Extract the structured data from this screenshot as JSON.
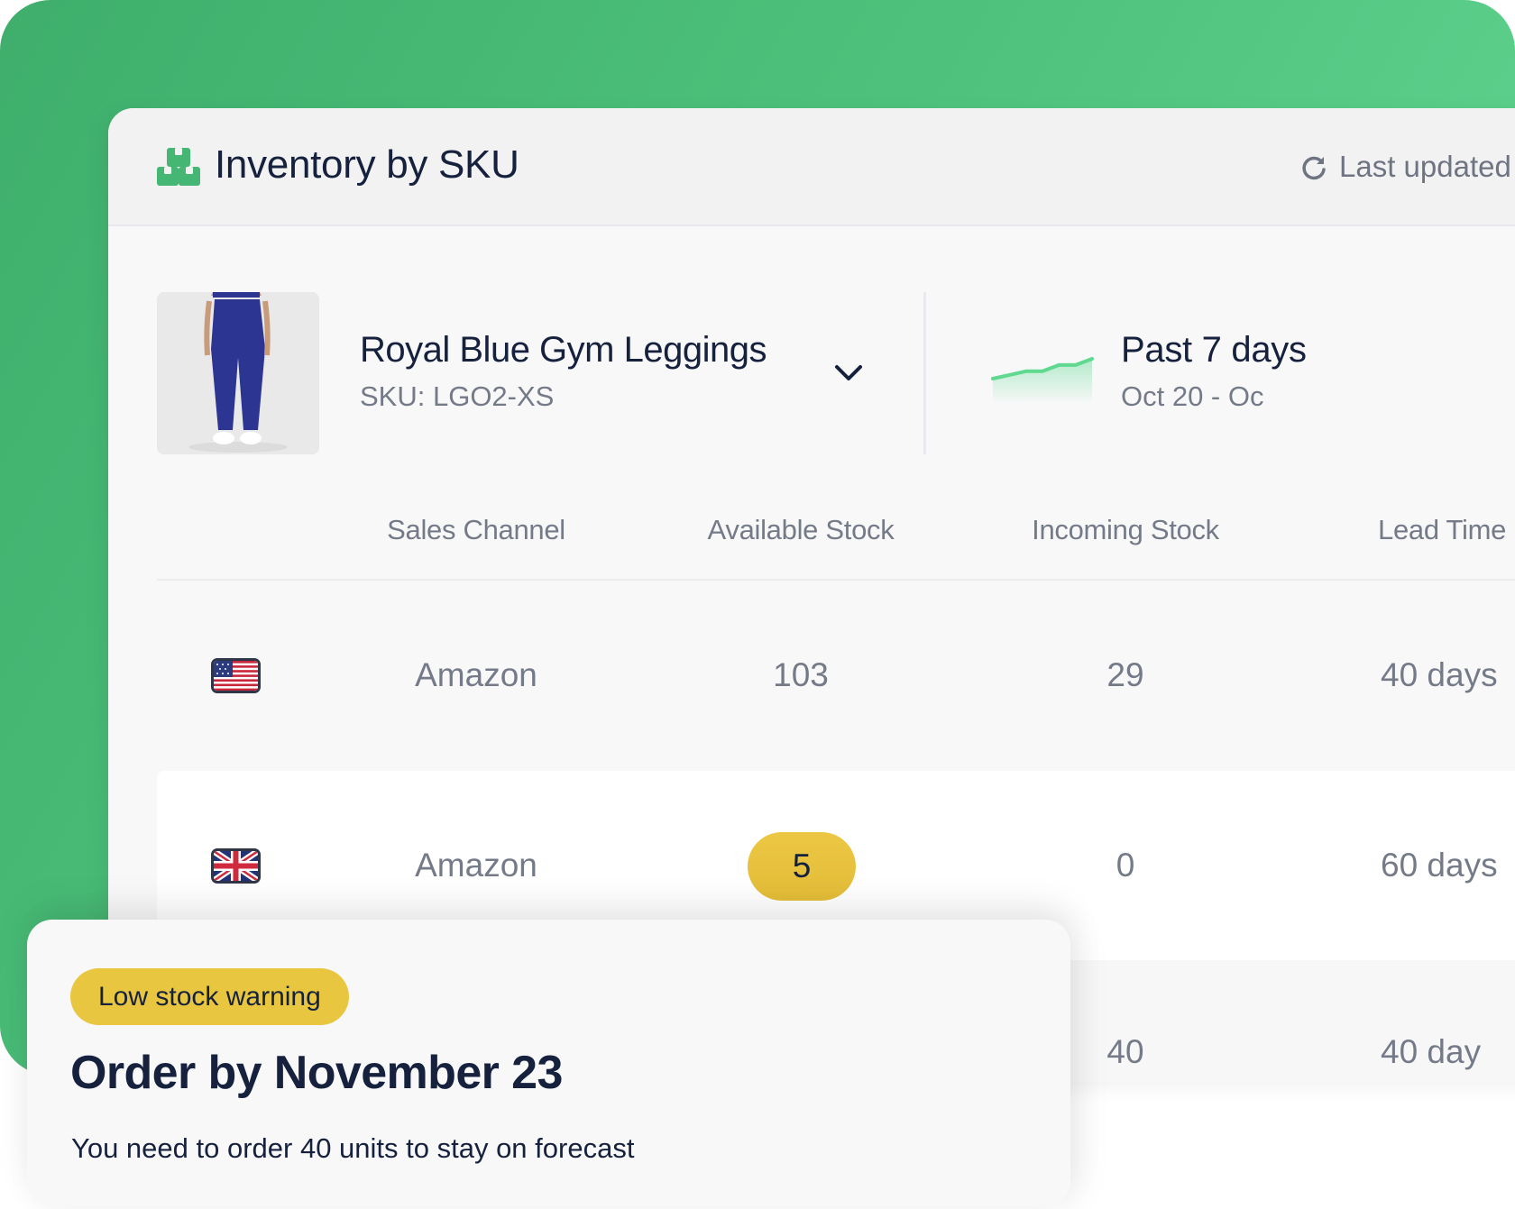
{
  "header": {
    "title": "Inventory by SKU",
    "logo_icon": "boxes-icon",
    "refresh_icon": "refresh-icon",
    "last_updated": "Last updated"
  },
  "product": {
    "name": "Royal Blue Gym Leggings",
    "sku": "SKU: LGO2-XS",
    "image_alt": "Royal blue leggings product photo",
    "dropdown_icon": "chevron-down-icon"
  },
  "range": {
    "title": "Past 7 days",
    "dates": "Oct 20 - Oc",
    "sparkline_values": [
      10,
      13,
      16,
      16,
      21,
      21,
      26
    ],
    "sparkline_color": "#5ed98f"
  },
  "table": {
    "columns": [
      "Sales Channel",
      "Available Stock",
      "Incoming Stock",
      "Lead Time"
    ],
    "rows": [
      {
        "flag": "us-flag-icon",
        "channel": "Amazon",
        "available": "103",
        "incoming": "29",
        "lead_time": "40 days"
      },
      {
        "flag": "uk-flag-icon",
        "channel": "Amazon",
        "available": "5",
        "incoming": "0",
        "lead_time": "60 days",
        "low_stock": true
      },
      {
        "flag": "",
        "channel": "",
        "available": "",
        "incoming": "40",
        "lead_time": "40 day"
      }
    ]
  },
  "warning": {
    "badge": "Low stock warning",
    "title": "Order by November 23",
    "description": "You need to order 40 units to stay on forecast"
  },
  "colors": {
    "brand_green": "#45b673",
    "warning_yellow": "#e9c63f",
    "text_dark": "#15213d",
    "text_muted": "#747a88"
  }
}
